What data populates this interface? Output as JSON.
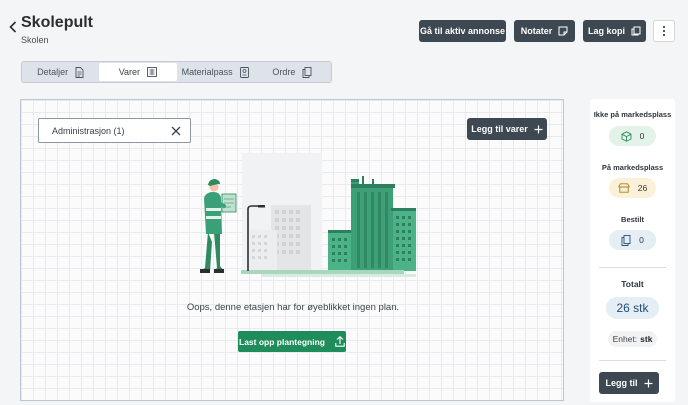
{
  "header": {
    "title": "Skolepult",
    "subtitle": "Skolen",
    "actions": {
      "go_to_ad": "Gå til aktiv annonse",
      "notes": "Notater",
      "copy": "Lag kopi"
    }
  },
  "tabs": [
    {
      "label": "Detaljer",
      "icon": "document-icon",
      "active": false
    },
    {
      "label": "Varer",
      "icon": "list-icon",
      "active": true
    },
    {
      "label": "Materialpass",
      "icon": "passport-icon",
      "active": false
    },
    {
      "label": "Ordre",
      "icon": "copy-icon",
      "active": false
    }
  ],
  "main": {
    "filter_value": "Administrasjon (1)",
    "add_items_label": "Legg til varer",
    "empty_message": "Oops, denne etasjen har for øyeblikket ingen plan.",
    "upload_label": "Last opp plantegning"
  },
  "sidebar": {
    "not_on_market": {
      "label": "Ikke på markedsplass",
      "count": "0",
      "icon": "cube-icon"
    },
    "on_market": {
      "label": "På markedsplass",
      "count": "26",
      "icon": "storefront-icon"
    },
    "ordered": {
      "label": "Bestilt",
      "count": "0",
      "icon": "copy-icon"
    },
    "total_label": "Totalt",
    "total_value": "26 stk",
    "unit_label": "Enhet:",
    "unit_value": "stk",
    "add_label": "Legg til"
  },
  "colors": {
    "dark_button": "#3d4852",
    "green_button": "#1e8c5b",
    "illustration_green": "#3aa077"
  }
}
